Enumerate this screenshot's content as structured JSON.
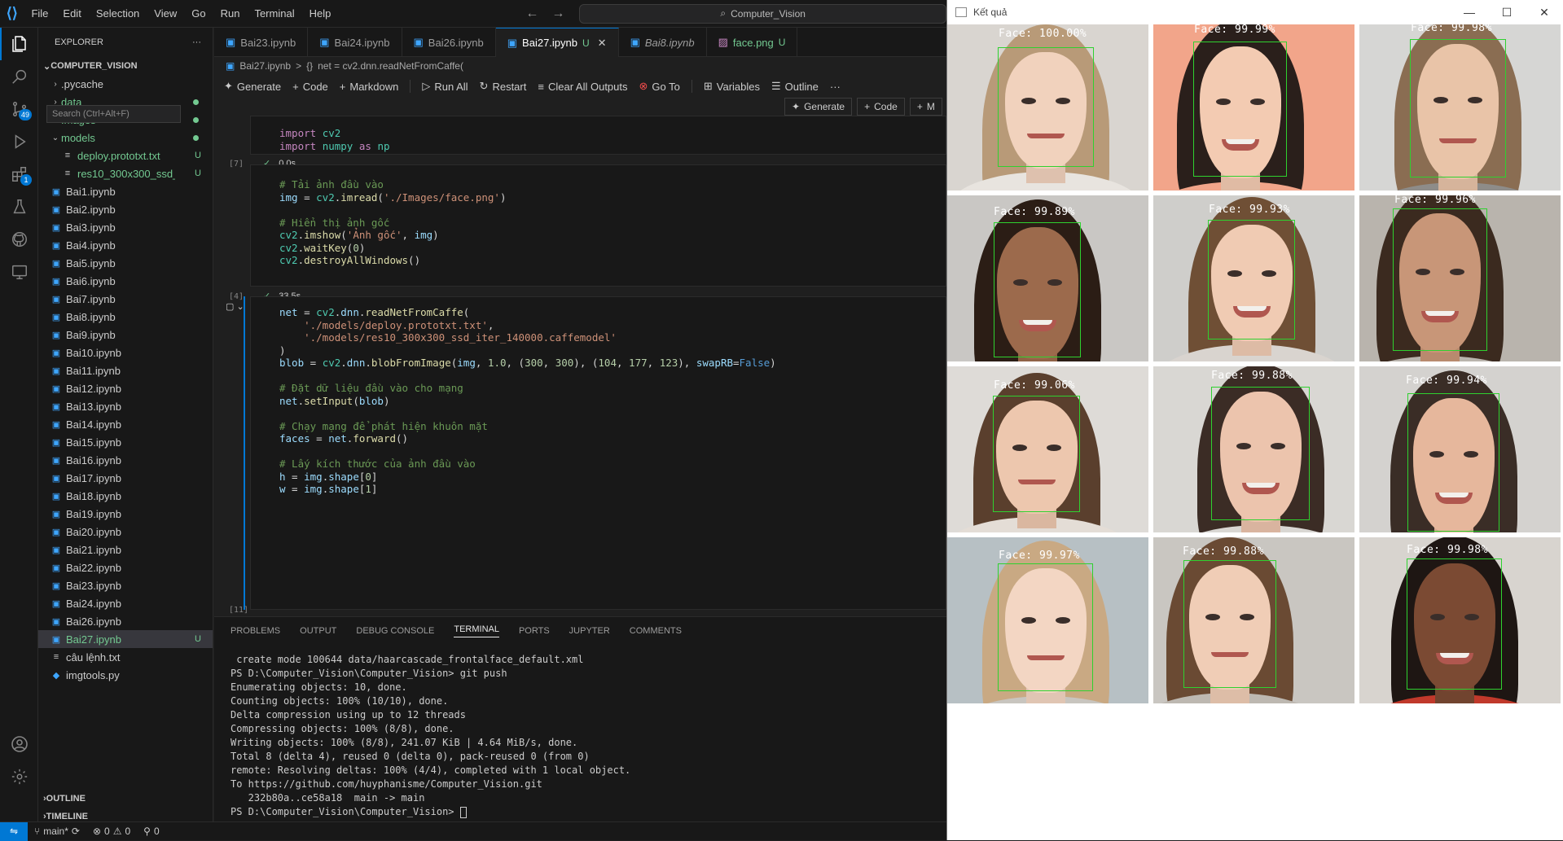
{
  "app": {
    "menu": [
      "File",
      "Edit",
      "Selection",
      "View",
      "Go",
      "Run",
      "Terminal",
      "Help"
    ],
    "search_text": "Computer_Vision"
  },
  "activity_badges": {
    "source_control": "49",
    "extensions": "1"
  },
  "explorer": {
    "title": "EXPLORER",
    "more": "···",
    "root": "COMPUTER_VISION",
    "search_overlay": "Search (Ctrl+Alt+F)",
    "items": [
      {
        "label": ".pycache",
        "kind": "folder",
        "status": ""
      },
      {
        "label": "data",
        "kind": "folder",
        "status": "dot"
      },
      {
        "label": "Images",
        "kind": "folder",
        "status": "dot"
      },
      {
        "label": "models",
        "kind": "folder-open",
        "status": "dot"
      },
      {
        "label": "deploy.prototxt.txt",
        "kind": "file-child",
        "status": "U"
      },
      {
        "label": "res10_300x300_ssd_iter...",
        "kind": "file-child",
        "status": "U"
      },
      {
        "label": "Bai1.ipynb",
        "kind": "nb",
        "status": ""
      },
      {
        "label": "Bai2.ipynb",
        "kind": "nb",
        "status": ""
      },
      {
        "label": "Bai3.ipynb",
        "kind": "nb",
        "status": ""
      },
      {
        "label": "Bai4.ipynb",
        "kind": "nb",
        "status": ""
      },
      {
        "label": "Bai5.ipynb",
        "kind": "nb",
        "status": ""
      },
      {
        "label": "Bai6.ipynb",
        "kind": "nb",
        "status": ""
      },
      {
        "label": "Bai7.ipynb",
        "kind": "nb",
        "status": ""
      },
      {
        "label": "Bai8.ipynb",
        "kind": "nb",
        "status": ""
      },
      {
        "label": "Bai9.ipynb",
        "kind": "nb",
        "status": ""
      },
      {
        "label": "Bai10.ipynb",
        "kind": "nb",
        "status": ""
      },
      {
        "label": "Bai11.ipynb",
        "kind": "nb",
        "status": ""
      },
      {
        "label": "Bai12.ipynb",
        "kind": "nb",
        "status": ""
      },
      {
        "label": "Bai13.ipynb",
        "kind": "nb",
        "status": ""
      },
      {
        "label": "Bai14.ipynb",
        "kind": "nb",
        "status": ""
      },
      {
        "label": "Bai15.ipynb",
        "kind": "nb",
        "status": ""
      },
      {
        "label": "Bai16.ipynb",
        "kind": "nb",
        "status": ""
      },
      {
        "label": "Bai17.ipynb",
        "kind": "nb",
        "status": ""
      },
      {
        "label": "Bai18.ipynb",
        "kind": "nb",
        "status": ""
      },
      {
        "label": "Bai19.ipynb",
        "kind": "nb",
        "status": ""
      },
      {
        "label": "Bai20.ipynb",
        "kind": "nb",
        "status": ""
      },
      {
        "label": "Bai21.ipynb",
        "kind": "nb",
        "status": ""
      },
      {
        "label": "Bai22.ipynb",
        "kind": "nb",
        "status": ""
      },
      {
        "label": "Bai23.ipynb",
        "kind": "nb",
        "status": ""
      },
      {
        "label": "Bai24.ipynb",
        "kind": "nb",
        "status": ""
      },
      {
        "label": "Bai26.ipynb",
        "kind": "nb",
        "status": ""
      },
      {
        "label": "Bai27.ipynb",
        "kind": "nb-selected",
        "status": "U"
      },
      {
        "label": "câu lệnh.txt",
        "kind": "txt",
        "status": ""
      },
      {
        "label": "imgtools.py",
        "kind": "py",
        "status": ""
      }
    ],
    "outline": "OUTLINE",
    "timeline": "TIMELINE"
  },
  "tabs": [
    {
      "label": "Bai23.ipynb",
      "status": "",
      "active": false
    },
    {
      "label": "Bai24.ipynb",
      "status": "",
      "active": false
    },
    {
      "label": "Bai26.ipynb",
      "status": "",
      "active": false
    },
    {
      "label": "Bai27.ipynb",
      "status": "U",
      "active": true
    },
    {
      "label": "Bai8.ipynb",
      "status": "",
      "active": false
    },
    {
      "label": "face.png",
      "status": "U",
      "active": false
    }
  ],
  "breadcrumb": {
    "file": "Bai27.ipynb",
    "sep": ">",
    "symbol": "net = cv2.dnn.readNetFromCaffe("
  },
  "toolbar": {
    "generate": "Generate",
    "code": "Code",
    "markdown": "Markdown",
    "run_all": "Run All",
    "restart": "Restart",
    "clear": "Clear All Outputs",
    "goto": "Go To",
    "variables": "Variables",
    "outline": "Outline",
    "more": "···"
  },
  "subtoolbar": {
    "generate": "Generate",
    "code": "Code",
    "more": "M"
  },
  "cells": [
    {
      "exec": "[7]",
      "time": "0.0s",
      "lines": [
        "import cv2",
        "import numpy as np"
      ]
    },
    {
      "exec": "[4]",
      "time": "33.5s",
      "lines": [
        "# Tải ảnh đầu vào",
        "img = cv2.imread('./Images/face.png')",
        "",
        "# Hiển thị ảnh gốc",
        "cv2.imshow('Ảnh gốc', img)",
        "cv2.waitKey(0)",
        "cv2.destroyAllWindows()"
      ]
    },
    {
      "exec": "[11]",
      "time": "",
      "lines": [
        "net = cv2.dnn.readNetFromCaffe(",
        "    './models/deploy.prototxt.txt',",
        "    './models/res10_300x300_ssd_iter_140000.caffemodel'",
        ")",
        "blob = cv2.dnn.blobFromImage(img, 1.0, (300, 300), (104, 177, 123), swapRB=False)",
        "",
        "# Đặt dữ liệu đầu vào cho mạng",
        "net.setInput(blob)",
        "",
        "# Chạy mạng để phát hiện khuôn mặt",
        "faces = net.forward()",
        "",
        "# Lấy kích thước của ảnh đầu vào",
        "h = img.shape[0]",
        "w = img.shape[1]"
      ]
    }
  ],
  "panel": {
    "tabs": [
      "PROBLEMS",
      "OUTPUT",
      "DEBUG CONSOLE",
      "TERMINAL",
      "PORTS",
      "JUPYTER",
      "COMMENTS"
    ],
    "active_tab": "TERMINAL",
    "terminal_lines": [
      " create mode 100644 data/haarcascade_frontalface_default.xml",
      "PS D:\\Computer_Vision\\Computer_Vision> git push",
      "Enumerating objects: 10, done.",
      "Counting objects: 100% (10/10), done.",
      "Delta compression using up to 12 threads",
      "Compressing objects: 100% (8/8), done.",
      "Writing objects: 100% (8/8), 241.07 KiB | 4.64 MiB/s, done.",
      "Total 8 (delta 4), reused 0 (delta 0), pack-reused 0 (from 0)",
      "remote: Resolving deltas: 100% (4/4), completed with 1 local object.",
      "To https://github.com/huyphanisme/Computer_Vision.git",
      "   232b80a..ce58a18  main -> main",
      "PS D:\\Computer_Vision\\Computer_Vision> "
    ]
  },
  "statusbar": {
    "branch": "main*",
    "errors": "0",
    "warnings": "0",
    "ports": "0"
  },
  "result_window": {
    "title": "Kết quả",
    "labels": [
      "Face: 100.00%",
      "Face: 99.99%",
      "Face: 99.98%",
      "Face: 99.89%",
      "Face: 99.93%",
      "Face: 99.96%",
      "Face: 99.06%",
      "Face: 99.88%",
      "Face: 99.94%",
      "Face: 99.97%",
      "Face: 99.88%",
      "Face: 99.98%"
    ]
  },
  "colors": {
    "accent": "#0078d4",
    "box": "#2fd12f",
    "untracked": "#73c991"
  }
}
